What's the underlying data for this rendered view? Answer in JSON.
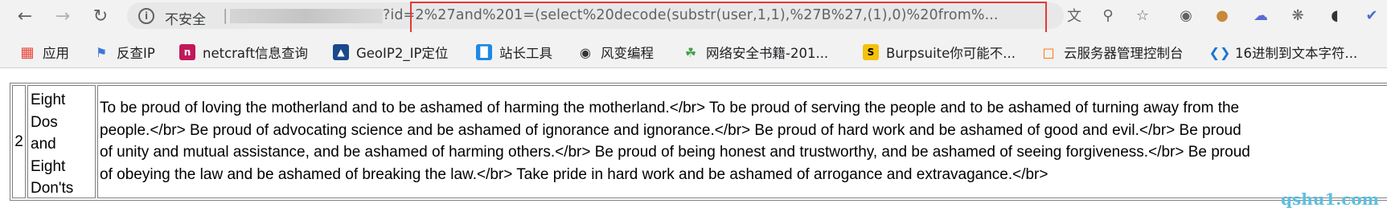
{
  "nav": {
    "back_icon": "arrow-left-icon",
    "forward_icon": "arrow-right-icon",
    "reload_icon": "reload-icon"
  },
  "address_bar": {
    "security_label": "不安全",
    "separator": "|",
    "url_suffix": "?id=2%27and%201=(select%20decode(substr(user,1,1),%27B%27,(1),0)%20from%..."
  },
  "toolbar_icons": [
    "translate-icon",
    "zoom-icon",
    "star-icon",
    "profile-icon",
    "cookie-icon",
    "cloud-icon",
    "extension-icon",
    "github-icon",
    "shield-icon"
  ],
  "bookmarks": [
    {
      "label": "应用",
      "icon": "apps-icon",
      "color": "#ea4335"
    },
    {
      "label": "反查IP",
      "icon": "flag-icon",
      "color": "#3c78d8"
    },
    {
      "label": "netcraft信息查询",
      "icon": "netcraft-icon",
      "color": "#c2185b"
    },
    {
      "label": "GeoIP2_IP定位",
      "icon": "geoip-icon",
      "color": "#1a4a8a"
    },
    {
      "label": "站长工具",
      "icon": "chinaz-icon",
      "color": "#1e88e5"
    },
    {
      "label": "风变编程",
      "icon": "panda-icon",
      "color": "#333333"
    },
    {
      "label": "网络安全书籍-201...",
      "icon": "cactus-icon",
      "color": "#43a047"
    },
    {
      "label": "Burpsuite你可能不...",
      "icon": "s-icon",
      "color": "#f4c20d"
    },
    {
      "label": "云服务器管理控制台",
      "icon": "cloud-console-icon",
      "color": "#ff6a00"
    },
    {
      "label": "16进制到文本字符...",
      "icon": "code-icon",
      "color": "#1976d2"
    }
  ],
  "table": {
    "id": "2",
    "title_lines": [
      "Eight",
      "Dos",
      "and",
      "Eight",
      "Don'ts"
    ],
    "content_lines": [
      "To be proud of loving the motherland and to be ashamed of harming the motherland.</br> To be proud of serving the people and to be ashamed of turning away from the",
      "people.</br> Be proud of advocating science and be ashamed of ignorance and ignorance.</br> Be proud of hard work and be ashamed of good and evil.</br> Be proud",
      "of unity and mutual assistance, and be ashamed of harming others.</br> Be proud of being honest and trustworthy, and be ashamed of seeing forgiveness.</br> Be proud",
      "of obeying the law and be ashamed of breaking the law.</br> Take pride in hard work and be ashamed of arrogance and extravagance.</br>"
    ]
  },
  "watermark": "qshu1.com"
}
